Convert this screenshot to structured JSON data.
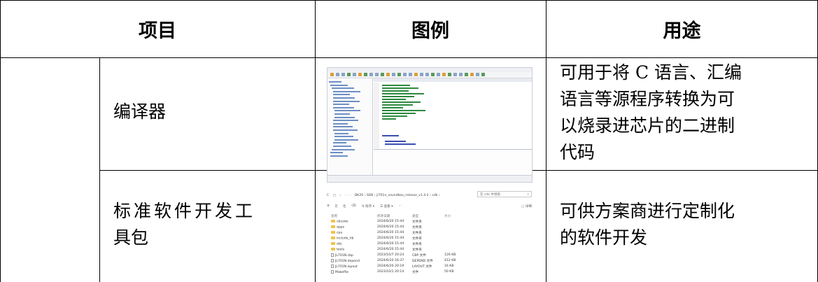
{
  "table": {
    "headers": {
      "item": "项目",
      "example": "图例",
      "usage": "用途"
    },
    "rows": [
      {
        "item": "编译器",
        "usage": [
          "可用于将 C 语言、汇编",
          "语言等源程序转换为可",
          "以烧录进芯片的二进制",
          "代码"
        ]
      },
      {
        "item": [
          "标准软件开发工",
          "具包"
        ],
        "usage": [
          "可供方案商进行定制化",
          "的软件开发"
        ]
      }
    ]
  },
  "explorer": {
    "nav": "C  ▢  ›  ···",
    "breadcrumb": "BK20  ›  SDK  ›  jl701n_soundbox_release_v1.4.2  ›  sdk  ›",
    "search_placeholder": "在 sdk 中搜索",
    "search_icon": "search-icon",
    "commands": [
      "⊕",
      "⎘",
      "⎗",
      "⌫",
      "⇅ 排序 ▾",
      "☰ 查看 ▾",
      "···"
    ],
    "details": "▢ 详细",
    "columns": [
      "名称",
      "修改日期",
      "类型",
      "大小"
    ],
    "rows": [
      {
        "name": "cbcode",
        "date": "2024/6/20 15:44",
        "type": "文件夹",
        "size": "",
        "kind": "folder"
      },
      {
        "name": "apps",
        "date": "2024/6/20 15:44",
        "type": "文件夹",
        "size": "",
        "kind": "folder"
      },
      {
        "name": "cpu",
        "date": "2024/6/20 15:44",
        "type": "文件夹",
        "size": "",
        "kind": "folder"
      },
      {
        "name": "include_lib",
        "date": "2024/6/20 15:44",
        "type": "文件夹",
        "size": "",
        "kind": "folder"
      },
      {
        "name": "obj",
        "date": "2024/6/20 15:44",
        "type": "文件夹",
        "size": "",
        "kind": "folder"
      },
      {
        "name": "tools",
        "date": "2024/6/20 15:44",
        "type": "文件夹",
        "size": "",
        "kind": "folder"
      },
      {
        "name": "JL701N.cbp",
        "date": "2023/10/7 20:24",
        "type": "CBP 文件",
        "size": "126 KB",
        "kind": "file"
      },
      {
        "name": "JL701N.depend",
        "date": "2024/6/20 16:37",
        "type": "DEPEND 文件",
        "size": "412 KB",
        "kind": "file"
      },
      {
        "name": "JL701N.layout",
        "date": "2024/6/20 20:19",
        "type": "LAYOUT 文件",
        "size": "16 KB",
        "kind": "file"
      },
      {
        "name": "Makefile",
        "date": "2023/10/1 20:14",
        "type": "文件",
        "size": "50 KB",
        "kind": "file"
      }
    ]
  }
}
